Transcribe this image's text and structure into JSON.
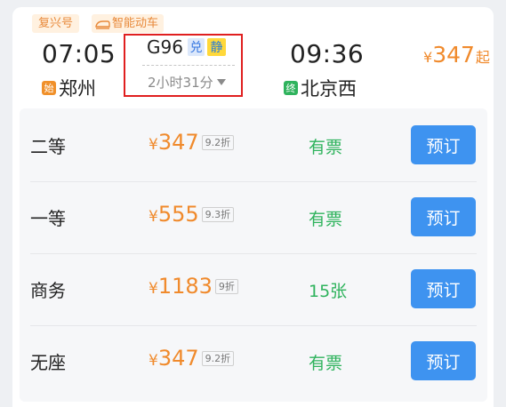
{
  "train": {
    "type_tag": "复兴号",
    "smart_tag": "智能动车",
    "number": "G96",
    "tag_exchange": "兑",
    "tag_quiet": "静",
    "duration": "2小时31分"
  },
  "departure": {
    "time": "07:05",
    "station_badge": "始",
    "station": "郑州"
  },
  "arrival": {
    "time": "09:36",
    "station_badge": "终",
    "station": "北京西"
  },
  "min_price": {
    "currency": "¥",
    "amount": "347",
    "suffix": "起"
  },
  "colors": {
    "accent_orange": "#f08a2c",
    "available_green": "#2fb35d",
    "button_blue": "#3e93f0",
    "highlight_red": "#e01f1f"
  },
  "seats": [
    {
      "name": "二等",
      "currency": "¥",
      "price": "347",
      "discount": "9.2折",
      "availability": "有票",
      "button": "预订"
    },
    {
      "name": "一等",
      "currency": "¥",
      "price": "555",
      "discount": "9.3折",
      "availability": "有票",
      "button": "预订"
    },
    {
      "name": "商务",
      "currency": "¥",
      "price": "1183",
      "discount": "9折",
      "availability": "15张",
      "button": "预订"
    },
    {
      "name": "无座",
      "currency": "¥",
      "price": "347",
      "discount": "9.2折",
      "availability": "有票",
      "button": "预订"
    }
  ]
}
